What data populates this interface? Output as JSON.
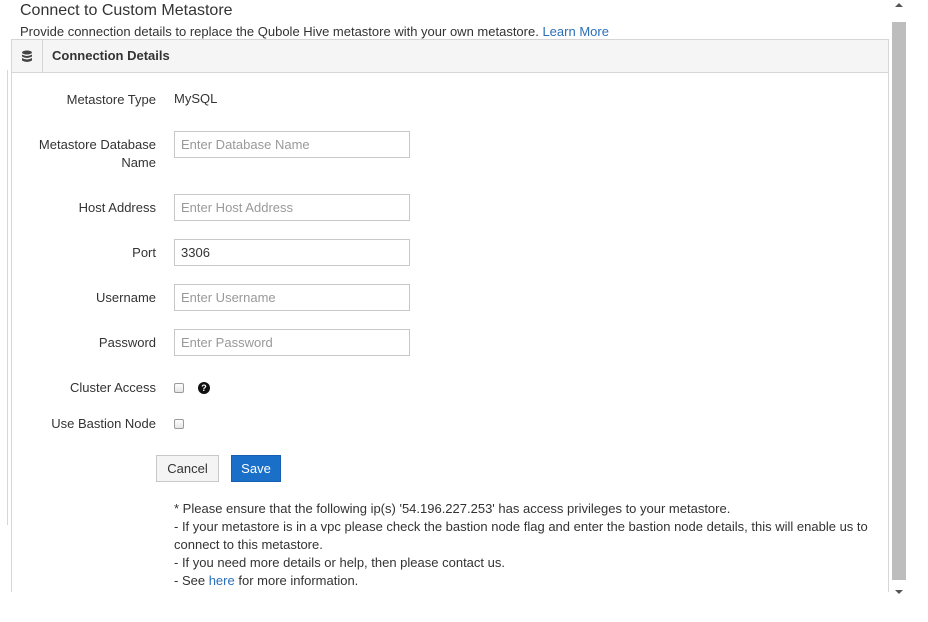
{
  "header": {
    "title": "Connect to Custom Metastore",
    "subtitle": "Provide connection details to replace the Qubole Hive metastore with your own metastore.",
    "learn_more": "Learn More"
  },
  "panel": {
    "icon": "database-icon",
    "title": "Connection Details"
  },
  "form": {
    "metastore_type": {
      "label": "Metastore Type",
      "value": "MySQL"
    },
    "database_name": {
      "label_line1": "Metastore Database",
      "label_line2": "Name",
      "value": "",
      "placeholder": "Enter Database Name"
    },
    "host_address": {
      "label": "Host Address",
      "value": "",
      "placeholder": "Enter Host Address"
    },
    "port": {
      "label": "Port",
      "value": "3306",
      "placeholder": ""
    },
    "username": {
      "label": "Username",
      "value": "",
      "placeholder": "Enter Username"
    },
    "password": {
      "label": "Password",
      "value": "",
      "placeholder": "Enter Password"
    },
    "cluster_access": {
      "label": "Cluster Access",
      "checked": false,
      "help_icon": "question-circle-icon"
    },
    "use_bastion_node": {
      "label": "Use Bastion Node",
      "checked": false
    }
  },
  "buttons": {
    "cancel": "Cancel",
    "save": "Save"
  },
  "notes": {
    "line1": "* Please ensure that the following ip(s) '54.196.227.253' has access privileges to your metastore.",
    "line2": "- If your metastore is in a vpc please check the bastion node flag and enter the bastion node details, this will enable us to connect to this metastore.",
    "line3": "- If you need more details or help, then please contact us.",
    "line4_prefix": "- See",
    "line4_link": "here",
    "line4_suffix": "for more information."
  },
  "colors": {
    "link": "#2a6fb8",
    "save_button": "#1a6fc9",
    "panel_header_bg": "#f5f5f5"
  }
}
